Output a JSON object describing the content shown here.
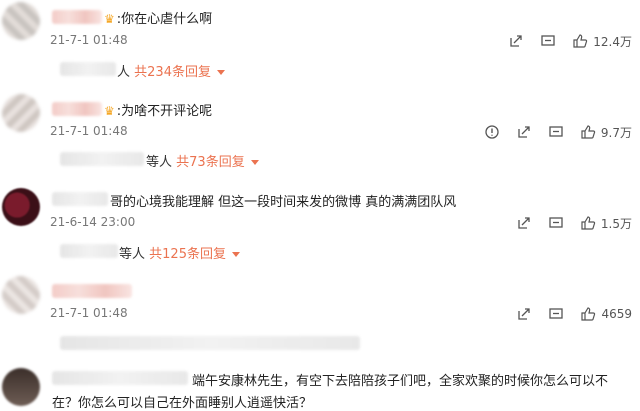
{
  "comments": [
    {
      "text": ":你在心虐什么啊",
      "time": "21-7-1 01:48",
      "likes": "12.4万",
      "replies_prefix": "人",
      "replies_link": "共234条回复"
    },
    {
      "text": ":为啥不开评论呢",
      "time": "21-7-1 01:48",
      "likes": "9.7万",
      "replies_prefix": "等人",
      "replies_link": "共73条回复"
    },
    {
      "text": "哥的心境我能理解   但这一段时间来发的微博   真的满满团队风",
      "time": "21-6-14 23:00",
      "likes": "1.5万",
      "replies_prefix": "等人",
      "replies_link": "共125条回复"
    },
    {
      "time": "21-7-1 01:48",
      "likes": "4659"
    },
    {
      "text_line1": "端午安康林先生，有空下去陪陪孩子们吧，全家欢聚的时候你怎么可以不",
      "text_line2": "在？你怎么可以自己在外面睡别人逍遥快活？"
    }
  ],
  "icons": {
    "crown": "crown-icon",
    "report": "report-icon",
    "share": "share-icon",
    "comment": "comment-icon",
    "like": "thumbs-up-icon"
  },
  "colors": {
    "link": "#eb7350",
    "crown": "#f5a623"
  }
}
